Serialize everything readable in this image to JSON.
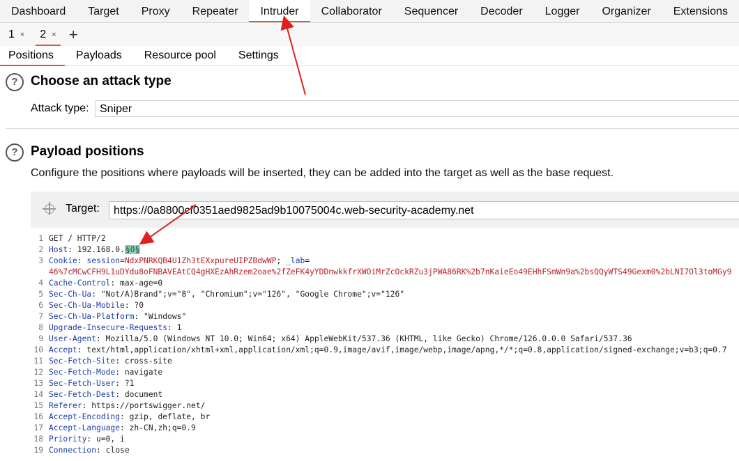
{
  "top_tabs": [
    "Dashboard",
    "Target",
    "Proxy",
    "Repeater",
    "Intruder",
    "Collaborator",
    "Sequencer",
    "Decoder",
    "Logger",
    "Organizer",
    "Extensions"
  ],
  "sub_tabs": [
    {
      "label": "1",
      "close": "×"
    },
    {
      "label": "2",
      "close": "×"
    }
  ],
  "add_tab": "+",
  "position_tabs": [
    "Positions",
    "Payloads",
    "Resource pool",
    "Settings"
  ],
  "attack_section": {
    "help_icon": "?",
    "title": "Choose an attack type",
    "attack_type_label": "Attack type:",
    "attack_type_value": "Sniper"
  },
  "payload_section": {
    "help_icon": "?",
    "title": "Payload positions",
    "description": "Configure the positions where payloads will be inserted, they can be added into the target as well as the base request.",
    "target_label": "Target:",
    "target_value": "https://0a8800cf0351aed9825ad9b10075004c.web-security-academy.net"
  },
  "request": {
    "request_line": "GET / HTTP/2",
    "host_name": "Host",
    "host_value": ": 192.168.0.",
    "host_marker": "§0§",
    "cookie_name": "Cookie",
    "cookie_sep": ": ",
    "cookie_session": "session",
    "cookie_session_value": "=NdxPNRKQB4U1Zh3tEXxpureUIPZBdwWP",
    "cookie_sep2": "; ",
    "cookie_lab": "_lab",
    "cookie_lab_eq": "=",
    "cookie_lab_value": "46%7cMCwCFH9L1uDYdu8oFNBAVEAtCQ4gHXEzAhRzem2oae%2fZeFK4yYDDnwkkfrXWOiMrZcOckRZu3jPWA86RK%2b7nKaieEo49EHhFSmWn9a%2bsQQyWTS49Gexm0%2bLNI7Ol3toMGy9",
    "headers": [
      {
        "num": "4",
        "name": "Cache-Control",
        "value": ": max-age=0"
      },
      {
        "num": "5",
        "name": "Sec-Ch-Ua",
        "value": ": \"Not/A)Brand\";v=\"8\", \"Chromium\";v=\"126\", \"Google Chrome\";v=\"126\""
      },
      {
        "num": "6",
        "name": "Sec-Ch-Ua-Mobile",
        "value": ": ?0"
      },
      {
        "num": "7",
        "name": "Sec-Ch-Ua-Platform",
        "value": ": \"Windows\""
      },
      {
        "num": "8",
        "name": "Upgrade-Insecure-Requests",
        "value": ": 1"
      },
      {
        "num": "9",
        "name": "User-Agent",
        "value": ": Mozilla/5.0 (Windows NT 10.0; Win64; x64) AppleWebKit/537.36 (KHTML, like Gecko) Chrome/126.0.0.0 Safari/537.36"
      },
      {
        "num": "10",
        "name": "Accept",
        "value": ": text/html,application/xhtml+xml,application/xml;q=0.9,image/avif,image/webp,image/apng,*/*;q=0.8,application/signed-exchange;v=b3;q=0.7"
      },
      {
        "num": "11",
        "name": "Sec-Fetch-Site",
        "value": ": cross-site"
      },
      {
        "num": "12",
        "name": "Sec-Fetch-Mode",
        "value": ": navigate"
      },
      {
        "num": "13",
        "name": "Sec-Fetch-User",
        "value": ": ?1"
      },
      {
        "num": "14",
        "name": "Sec-Fetch-Dest",
        "value": ": document"
      },
      {
        "num": "15",
        "name": "Referer",
        "value": ": https://portswigger.net/"
      },
      {
        "num": "16",
        "name": "Accept-Encoding",
        "value": ": gzip, deflate, br"
      },
      {
        "num": "17",
        "name": "Accept-Language",
        "value": ": zh-CN,zh;q=0.9"
      },
      {
        "num": "18",
        "name": "Priority",
        "value": ": u=0, i"
      },
      {
        "num": "19",
        "name": "Connection",
        "value": ": close"
      }
    ],
    "line_numbers": [
      "1",
      "2",
      "3",
      "4",
      "5"
    ]
  },
  "colors": {
    "accent": "#e8572c",
    "header_name": "#1c3fa8",
    "cookie_value": "#b5222a",
    "marker_bg": "#8fcfb7",
    "annotation_arrow": "#e02020"
  }
}
